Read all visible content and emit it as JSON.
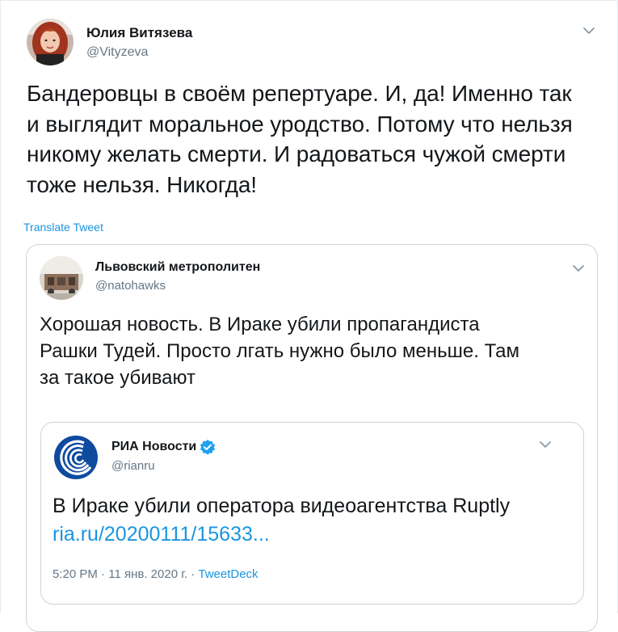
{
  "tweet": {
    "author_name": "Юлия Витязева",
    "author_handle": "@Vityzeva",
    "text_lines": [
      "Бандеровцы в своём репертуаре. И, да! Именно так",
      "и выглядит моральное уродство. Потому что нельзя",
      "никому желать смерти. И радоваться чужой смерти",
      "тоже нельзя. Никогда!"
    ],
    "translate_label": "Translate Tweet",
    "menu_icon": "chevron-down-icon"
  },
  "quoted": {
    "author_name": "Львовский метрополитен",
    "author_handle": "@natohawks",
    "text_lines": [
      "Хорошая новость. В Ираке убили пропагандиста",
      "Рашки Тудей. Просто лгать нужно было меньше. Там",
      "за такое убивают"
    ],
    "menu_icon": "chevron-down-icon"
  },
  "inner_quoted": {
    "author_name": "РИА Новости",
    "author_handle": "@rianru",
    "verified_icon": "verified-badge-icon",
    "text": "В Ираке убили оператора видеоагентства Ruptly",
    "link": "ria.ru/20200111/15633...",
    "time": "5:20 PM",
    "separator": "·",
    "date": "11 янв. 2020 г.",
    "source": "TweetDeck",
    "menu_icon": "chevron-down-icon"
  },
  "colors": {
    "text": "#14171a",
    "secondary": "#657786",
    "link": "#1b95e0",
    "border": "#ccd6dd",
    "verified": "#1da1f2",
    "ria_logo": "#0e4a9e"
  }
}
